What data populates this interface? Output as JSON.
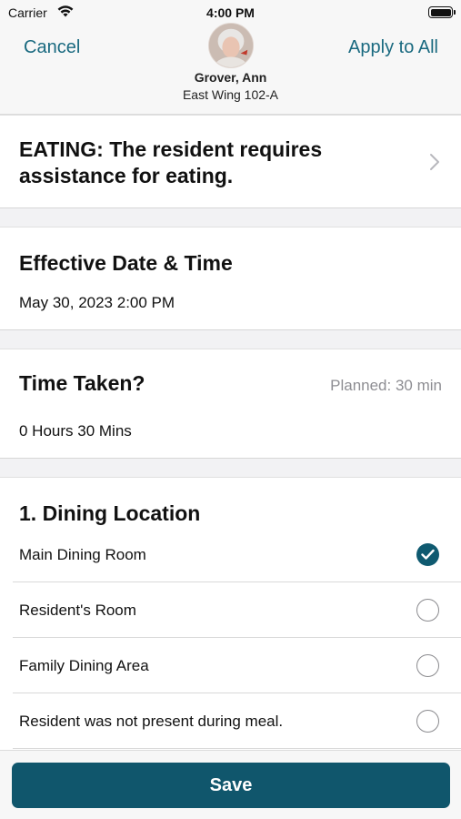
{
  "status_bar": {
    "carrier": "Carrier",
    "time": "4:00 PM"
  },
  "header": {
    "cancel_label": "Cancel",
    "apply_label": "Apply to All",
    "resident_name": "Grover, Ann",
    "resident_location": "East Wing 102-A",
    "accent_color": "#1a6a80"
  },
  "task": {
    "title": "EATING: The resident requires assistance for eating."
  },
  "effective": {
    "title": "Effective Date & Time",
    "value": "May 30, 2023 2:00 PM"
  },
  "time_taken": {
    "title": "Time Taken?",
    "planned": "Planned: 30 min",
    "value": "0 Hours 30 Mins"
  },
  "dining": {
    "title": "1. Dining Location",
    "options": [
      {
        "label": "Main Dining Room",
        "selected": true
      },
      {
        "label": "Resident's Room",
        "selected": false
      },
      {
        "label": "Family Dining Area",
        "selected": false
      },
      {
        "label": "Resident was not present during meal.",
        "selected": false
      }
    ]
  },
  "footer": {
    "save_label": "Save",
    "button_color": "#10566c"
  }
}
